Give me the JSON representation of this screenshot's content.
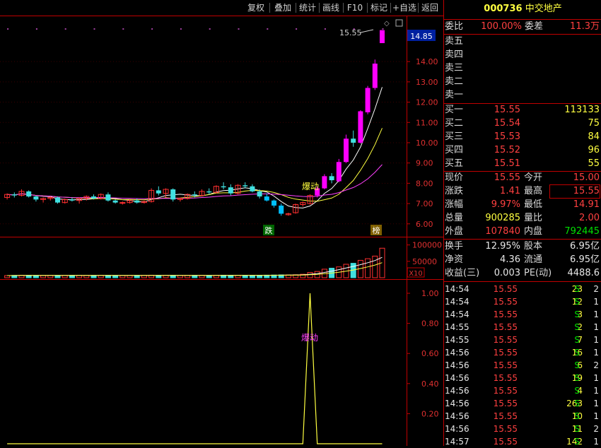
{
  "toolbar": {
    "buttons": [
      "复权",
      "叠加",
      "统计",
      "画线",
      "F10",
      "标记",
      "+自选",
      "返回"
    ]
  },
  "stock": {
    "code": "000736",
    "name": "中交地产"
  },
  "commission": {
    "ratio_label": "委比",
    "ratio": "100.00%",
    "diff_label": "委差",
    "diff": "11.3万"
  },
  "asks": [
    {
      "label": "卖五"
    },
    {
      "label": "卖四"
    },
    {
      "label": "卖三"
    },
    {
      "label": "卖二"
    },
    {
      "label": "卖一"
    }
  ],
  "bids": [
    {
      "label": "买一",
      "price": "15.55",
      "vol": "113133"
    },
    {
      "label": "买二",
      "price": "15.54",
      "vol": "75"
    },
    {
      "label": "买三",
      "price": "15.53",
      "vol": "84"
    },
    {
      "label": "买四",
      "price": "15.52",
      "vol": "96"
    },
    {
      "label": "买五",
      "price": "15.51",
      "vol": "55"
    }
  ],
  "quote": [
    {
      "l1": "现价",
      "v1": "15.55",
      "l2": "今开",
      "v2": "15.00"
    },
    {
      "l1": "涨跌",
      "v1": "1.41",
      "l2": "最高",
      "v2": "15.55"
    },
    {
      "l1": "涨幅",
      "v1": "9.97%",
      "l2": "最低",
      "v2": "14.91"
    },
    {
      "l1": "总量",
      "v1": "900285",
      "l2": "量比",
      "v2": "2.00"
    },
    {
      "l1": "外盘",
      "v1": "107840",
      "l2": "内盘",
      "v2": "792445"
    }
  ],
  "fundamentals": [
    {
      "l1": "换手",
      "v1": "12.95%",
      "l2": "股本",
      "v2": "6.95亿"
    },
    {
      "l1": "净资",
      "v1": "4.36",
      "l2": "流通",
      "v2": "6.95亿"
    },
    {
      "l1": "收益(三)",
      "v1": "0.003",
      "l2": "PE(动)",
      "v2": "4488.6"
    }
  ],
  "trades": [
    {
      "time": "14:54",
      "price": "15.55",
      "vol": "23",
      "side": "S",
      "n": "2"
    },
    {
      "time": "14:54",
      "price": "15.55",
      "vol": "12",
      "side": "S",
      "n": "1"
    },
    {
      "time": "14:54",
      "price": "15.55",
      "vol": "3",
      "side": "S",
      "n": "1"
    },
    {
      "time": "14:55",
      "price": "15.55",
      "vol": "2",
      "side": "S",
      "n": "1"
    },
    {
      "time": "14:55",
      "price": "15.55",
      "vol": "7",
      "side": "S",
      "n": "1"
    },
    {
      "time": "14:56",
      "price": "15.55",
      "vol": "16",
      "side": "S",
      "n": "1"
    },
    {
      "time": "14:56",
      "price": "15.55",
      "vol": "6",
      "side": "S",
      "n": "2"
    },
    {
      "time": "14:56",
      "price": "15.55",
      "vol": "19",
      "side": "S",
      "n": "1"
    },
    {
      "time": "14:56",
      "price": "15.55",
      "vol": "4",
      "side": "S",
      "n": "1"
    },
    {
      "time": "14:56",
      "price": "15.55",
      "vol": "263",
      "side": "S",
      "n": "1"
    },
    {
      "time": "14:56",
      "price": "15.55",
      "vol": "10",
      "side": "S",
      "n": "1"
    },
    {
      "time": "14:56",
      "price": "15.55",
      "vol": "11",
      "side": "S",
      "n": "2"
    },
    {
      "time": "14:57",
      "price": "15.55",
      "vol": "142",
      "side": "S",
      "n": "1"
    }
  ],
  "chart_data": {
    "type": "candlestick",
    "price_axis": {
      "ticks": [
        "14.00",
        "13.00",
        "12.00",
        "11.00",
        "10.00",
        "9.00",
        "8.00",
        "7.00",
        "6.00"
      ],
      "ylim": [
        5.4,
        16.2
      ],
      "current": "14.85"
    },
    "volume_axis": {
      "ticks": [
        "100000",
        "50000"
      ],
      "multiplier": "X10"
    },
    "indicator_axis": {
      "ticks": [
        "1.00",
        "0.80",
        "0.60",
        "0.40",
        "0.20"
      ],
      "ylim": [
        0,
        1.08
      ]
    },
    "annotations": {
      "high_label": "15.55",
      "signal_label": "爆动",
      "fall_marker": "跌",
      "rank_marker": "榜",
      "indicator_label": "爆动"
    },
    "candles": [
      [
        7.3,
        7.5,
        7.2,
        7.45
      ],
      [
        7.45,
        7.55,
        7.3,
        7.4
      ],
      [
        7.4,
        7.7,
        7.35,
        7.6
      ],
      [
        7.6,
        7.65,
        7.3,
        7.35
      ],
      [
        7.35,
        7.4,
        7.1,
        7.2
      ],
      [
        7.2,
        7.3,
        7.05,
        7.25
      ],
      [
        7.25,
        7.35,
        7.15,
        7.3
      ],
      [
        7.3,
        7.35,
        7.0,
        7.05
      ],
      [
        7.05,
        7.25,
        7.0,
        7.2
      ],
      [
        7.2,
        7.3,
        7.1,
        7.15
      ],
      [
        7.15,
        7.3,
        7.0,
        7.25
      ],
      [
        7.25,
        7.4,
        7.15,
        7.35
      ],
      [
        7.35,
        7.45,
        7.2,
        7.25
      ],
      [
        7.25,
        7.5,
        7.2,
        7.45
      ],
      [
        7.45,
        7.55,
        7.1,
        7.15
      ],
      [
        7.15,
        7.2,
        7.0,
        7.05
      ],
      [
        7.05,
        7.1,
        6.95,
        7.05
      ],
      [
        7.05,
        7.2,
        7.0,
        7.15
      ],
      [
        7.15,
        7.25,
        7.0,
        7.05
      ],
      [
        7.05,
        7.15,
        7.0,
        7.1
      ],
      [
        7.1,
        7.75,
        7.05,
        7.65
      ],
      [
        7.65,
        7.85,
        7.4,
        7.5
      ],
      [
        7.5,
        7.75,
        7.3,
        7.7
      ],
      [
        7.7,
        7.75,
        7.1,
        7.2
      ],
      [
        7.2,
        7.3,
        7.1,
        7.25
      ],
      [
        7.25,
        7.5,
        7.2,
        7.45
      ],
      [
        7.45,
        7.6,
        7.3,
        7.4
      ],
      [
        7.4,
        7.7,
        7.35,
        7.6
      ],
      [
        7.6,
        7.75,
        7.45,
        7.55
      ],
      [
        7.55,
        7.9,
        7.5,
        7.85
      ],
      [
        7.85,
        8.05,
        7.7,
        7.8
      ],
      [
        7.8,
        7.95,
        7.4,
        7.5
      ],
      [
        7.5,
        7.95,
        7.45,
        7.9
      ],
      [
        7.9,
        8.05,
        7.75,
        7.85
      ],
      [
        7.85,
        7.95,
        7.55,
        7.6
      ],
      [
        7.6,
        7.7,
        7.25,
        7.35
      ],
      [
        7.35,
        7.5,
        7.1,
        7.15
      ],
      [
        7.15,
        7.2,
        6.8,
        6.9
      ],
      [
        6.9,
        7.0,
        6.4,
        6.5
      ],
      [
        6.45,
        6.55,
        6.4,
        6.5
      ],
      [
        6.55,
        7.0,
        6.5,
        6.95
      ],
      [
        6.95,
        7.1,
        6.85,
        7.05
      ],
      [
        7.0,
        7.45,
        6.95,
        7.4
      ],
      [
        7.4,
        7.85,
        7.3,
        7.75
      ],
      [
        7.75,
        8.45,
        7.7,
        8.35
      ],
      [
        8.35,
        8.5,
        8.0,
        8.15
      ],
      [
        8.1,
        9.2,
        8.05,
        9.05
      ],
      [
        9.05,
        10.4,
        9.0,
        10.2
      ],
      [
        10.2,
        10.6,
        9.8,
        10.0
      ],
      [
        10.0,
        11.6,
        9.95,
        11.55
      ],
      [
        11.5,
        12.8,
        11.4,
        12.7
      ],
      [
        12.7,
        14.1,
        12.6,
        13.9
      ],
      [
        14.91,
        15.55,
        14.91,
        15.55
      ]
    ],
    "volumes": [
      6500,
      7000,
      7500,
      7300,
      6800,
      6600,
      6800,
      7000,
      6900,
      7100,
      7200,
      7000,
      6900,
      7300,
      7200,
      6700,
      6500,
      6800,
      7000,
      7200,
      7600,
      7300,
      7100,
      7000,
      6900,
      7100,
      7200,
      7300,
      7000,
      7500,
      7600,
      7300,
      7200,
      7400,
      7100,
      7500,
      7800,
      8200,
      8600,
      8400,
      9000,
      10500,
      16000,
      19000,
      26000,
      29000,
      33000,
      41000,
      44000,
      53000,
      58000,
      66000,
      90028
    ],
    "signal": [
      0,
      0,
      0,
      0,
      0,
      0,
      0,
      0,
      0,
      0,
      0,
      0,
      0,
      0,
      0,
      0,
      0,
      0,
      0,
      0,
      0,
      0,
      0,
      0,
      0,
      0,
      0,
      0,
      0,
      0,
      0,
      0,
      0,
      0,
      0,
      0,
      0,
      0,
      0,
      0,
      0,
      0,
      1,
      0,
      0,
      0,
      0,
      0,
      0,
      0,
      0,
      0,
      0
    ]
  }
}
